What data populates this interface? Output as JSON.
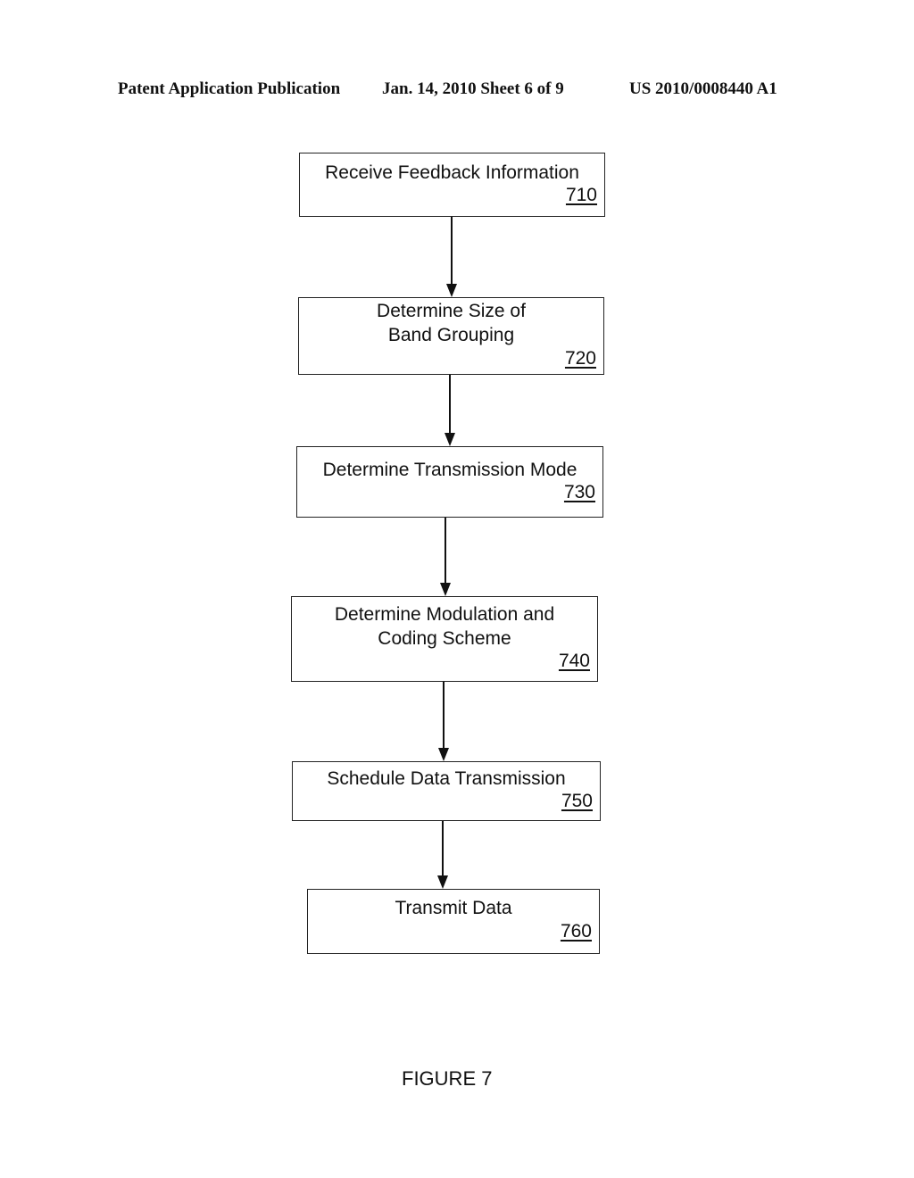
{
  "header": {
    "left": "Patent Application Publication",
    "center": "Jan. 14, 2010  Sheet 6 of 9",
    "right": "US 2010/0008440 A1"
  },
  "steps": [
    {
      "label": "Receive Feedback Information",
      "ref": "710"
    },
    {
      "label": "Determine Size of Band Grouping",
      "ref": "720"
    },
    {
      "label": "Determine Transmission Mode",
      "ref": "730"
    },
    {
      "label": "Determine Modulation and Coding Scheme",
      "ref": "740"
    },
    {
      "label": "Schedule Data Transmission",
      "ref": "750"
    },
    {
      "label": "Transmit Data",
      "ref": "760"
    }
  ],
  "caption": "FIGURE 7"
}
